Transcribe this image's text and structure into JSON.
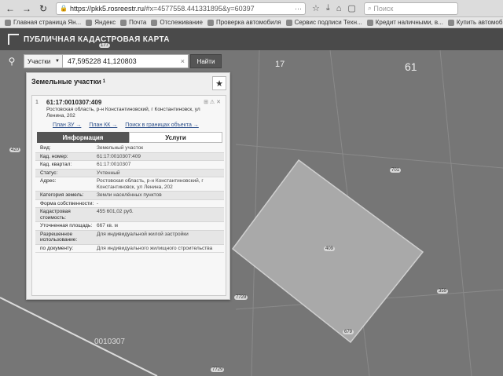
{
  "browser": {
    "url_host": "https://pkk5.rosreestr.ru/",
    "url_rest": "#x=4577558.441331895&y=60397",
    "search_placeholder": "Поиск",
    "nav": {
      "back": "←",
      "forward": "→",
      "reload": "↻"
    },
    "icons": [
      "bookmark-icon",
      "download-icon",
      "home-icon",
      "chat-icon"
    ],
    "bookmarks": [
      "Главная страница Ян...",
      "Яндекс",
      "Почта",
      "Отслеживание",
      "Проверка автомобиля",
      "Сервис подписи Техн...",
      "Кредит наличными, в...",
      "Купить автомоб"
    ]
  },
  "app": {
    "title": "ПУБЛИЧНАЯ КАДАСТРОВАЯ КАРТА"
  },
  "search": {
    "type_label": "Участки",
    "value": "47,595228 41,120803",
    "button": "Найти"
  },
  "map": {
    "labels": [
      "17",
      "61"
    ],
    "tags": [
      "177",
      "420",
      "701",
      "7729",
      "359",
      "679",
      "7729"
    ],
    "quarter_label": "0010307",
    "plot_label": "409"
  },
  "panel": {
    "header": "Земельные участки",
    "header_count": "1",
    "card": {
      "index": "1",
      "cad_number": "61:17:0010307:409",
      "address": "Ростовская область, р-н Константиновский, г Константиновск, ул Ленина, 202",
      "links": [
        "План ЗУ →",
        "План КК →",
        "Поиск в границах объекта →"
      ],
      "tabs": [
        "Информация",
        "Услуги"
      ],
      "rows": [
        {
          "k": "Вид:",
          "v": "Земельный участок"
        },
        {
          "k": "Кад. номер:",
          "v": "61:17:0010307:409"
        },
        {
          "k": "Кад. квартал:",
          "v": "61:17:0010307"
        },
        {
          "k": "Статус:",
          "v": "Учтенный"
        },
        {
          "k": "Адрес:",
          "v": "Ростовская область, р-н Константиновский, г Константиновск, ул Ленина, 202"
        },
        {
          "k": "Категория земель:",
          "v": "Земли населённых пунктов"
        },
        {
          "k": "Форма собственности:",
          "v": "-"
        },
        {
          "k": "Кадастровая стоимость:",
          "v": "455 601,02 руб."
        },
        {
          "k": "Уточненная площадь:",
          "v": "667 кв. м"
        },
        {
          "k": "Разрешенное использование:",
          "v": "Для индивидуальной жилой застройки"
        },
        {
          "k": "по документу:",
          "v": "Для индивидуального жилищного строительства"
        }
      ]
    }
  }
}
